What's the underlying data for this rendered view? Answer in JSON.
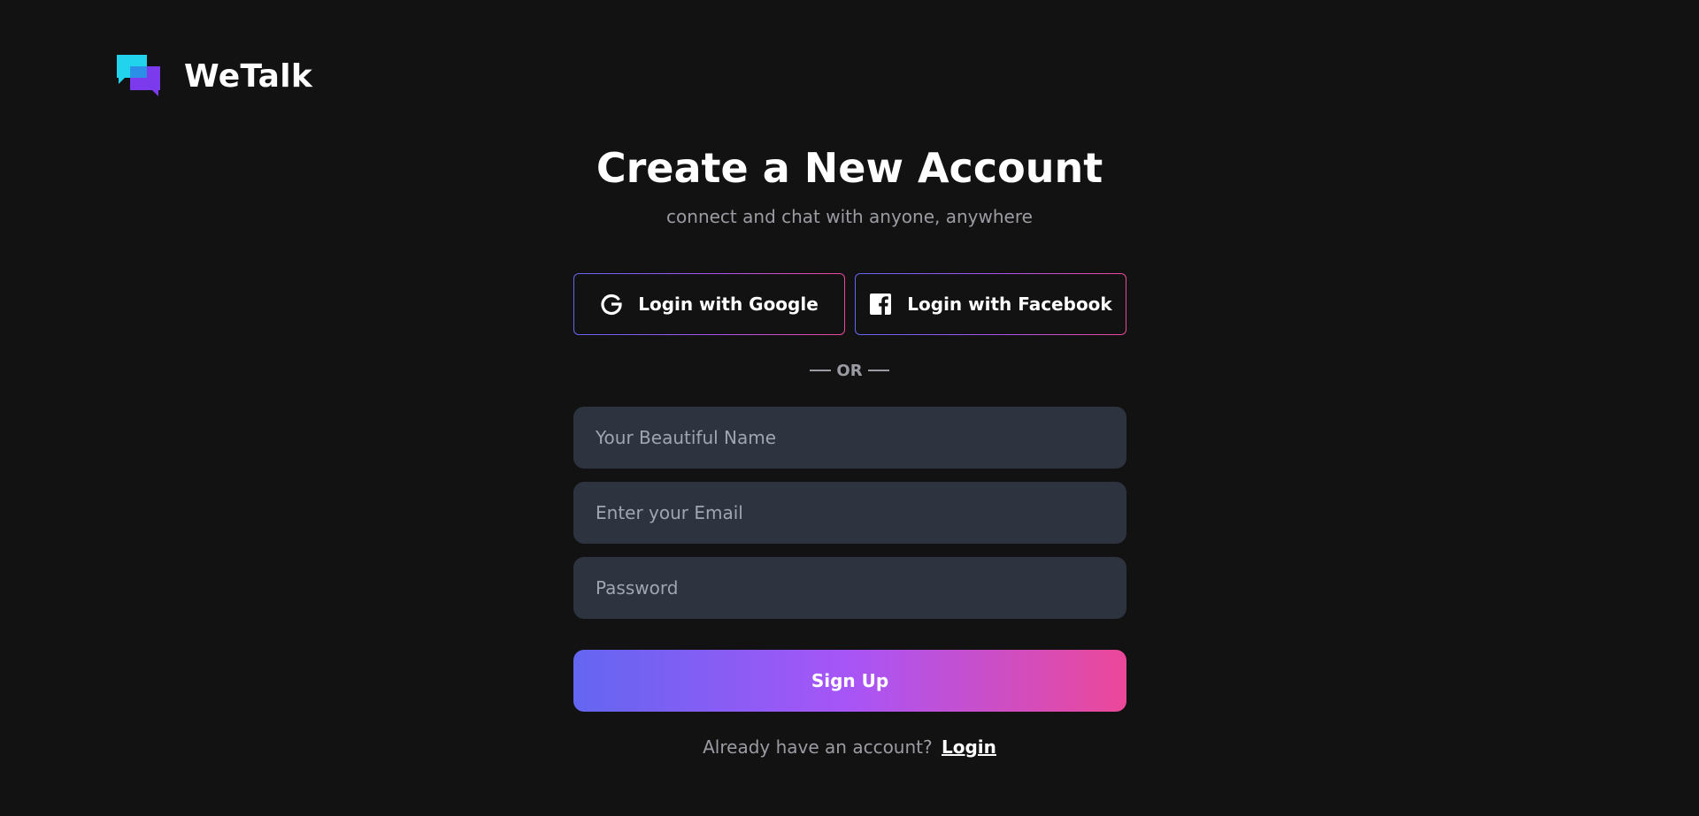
{
  "brand": {
    "name": "WeTalk",
    "logo_icon": "chat-bubbles-icon",
    "logo_colors": [
      "#22d3ee",
      "#7c3aed"
    ]
  },
  "header": {
    "title": "Create a New Account",
    "subtitle": "connect and chat with anyone, anywhere"
  },
  "social": {
    "google_label": "Login with Google",
    "google_icon": "google-icon",
    "facebook_label": "Login with Facebook",
    "facebook_icon": "facebook-icon"
  },
  "divider": {
    "text": "OR"
  },
  "form": {
    "name_placeholder": "Your Beautiful Name",
    "name_value": "",
    "email_placeholder": "Enter your Email",
    "email_value": "",
    "password_placeholder": "Password",
    "password_value": "",
    "submit_label": "Sign Up"
  },
  "footer": {
    "prompt": "Already have an account?",
    "login_label": "Login"
  },
  "colors": {
    "background": "#121212",
    "input_background": "#2d333f",
    "gradient_start": "#6366f1",
    "gradient_mid": "#a855f7",
    "gradient_end": "#ec4899",
    "muted_text": "#9b9ca3"
  }
}
